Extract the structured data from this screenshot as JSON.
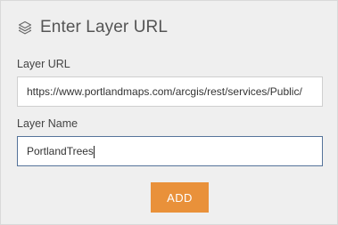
{
  "header": {
    "icon": "layers-icon",
    "title": "Enter Layer URL"
  },
  "form": {
    "layer_url": {
      "label": "Layer URL",
      "value": "https://www.portlandmaps.com/arcgis/rest/services/Public/"
    },
    "layer_name": {
      "label": "Layer Name",
      "value": "PortlandTrees"
    }
  },
  "actions": {
    "add_label": "ADD"
  },
  "colors": {
    "panel_background": "#efefef",
    "add_button": "#e9913a",
    "focused_border": "#55739a"
  }
}
